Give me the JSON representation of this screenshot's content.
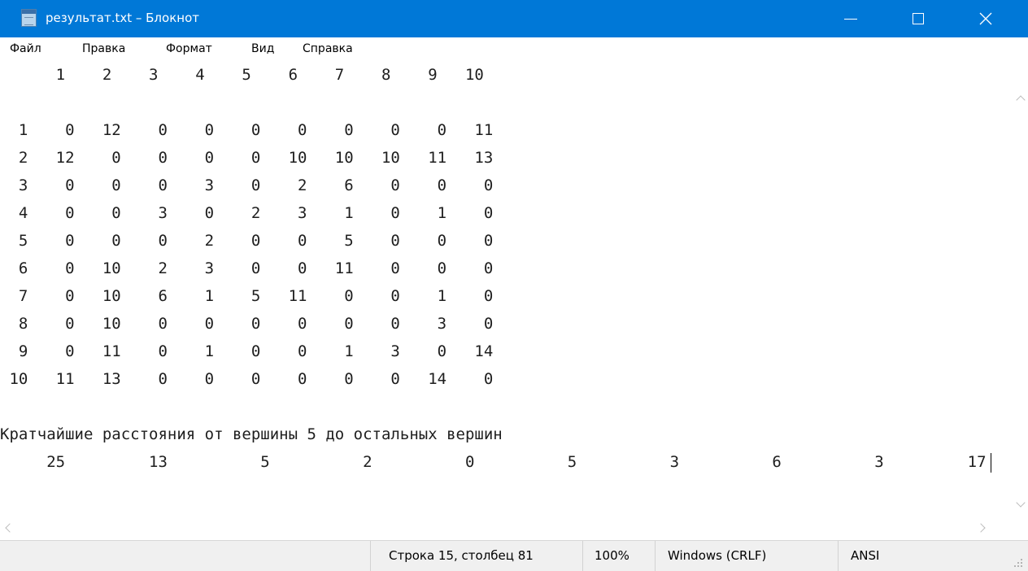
{
  "window": {
    "title": "результат.txt – Блокнот"
  },
  "menu": [
    "Файл",
    "Правка",
    "Формат",
    "Вид",
    "Справка"
  ],
  "editor": {
    "lines": [
      "      1    2    3    4    5    6    7    8    9   10",
      "",
      "  1    0   12    0    0    0    0    0    0    0   11",
      "  2   12    0    0    0    0   10   10   10   11   13",
      "  3    0    0    0    3    0    2    6    0    0    0",
      "  4    0    0    3    0    2    3    1    0    1    0",
      "  5    0    0    0    2    0    0    5    0    0    0",
      "  6    0   10    2    3    0    0   11    0    0    0",
      "  7    0   10    6    1    5   11    0    0    1    0",
      "  8    0   10    0    0    0    0    0    0    3    0",
      "  9    0   11    0    1    0    0    1    3    0   14",
      " 10   11   13    0    0    0    0    0    0   14    0",
      "",
      "Кратчайшие расстояния от вершины 5 до остальных вершин",
      "     25         13          5          2          0          5          3          6          3         17"
    ]
  },
  "statusbar": {
    "position": "Строка 15, столбец 81",
    "zoom": "100%",
    "line_ending": "Windows (CRLF)",
    "encoding": "ANSI"
  }
}
